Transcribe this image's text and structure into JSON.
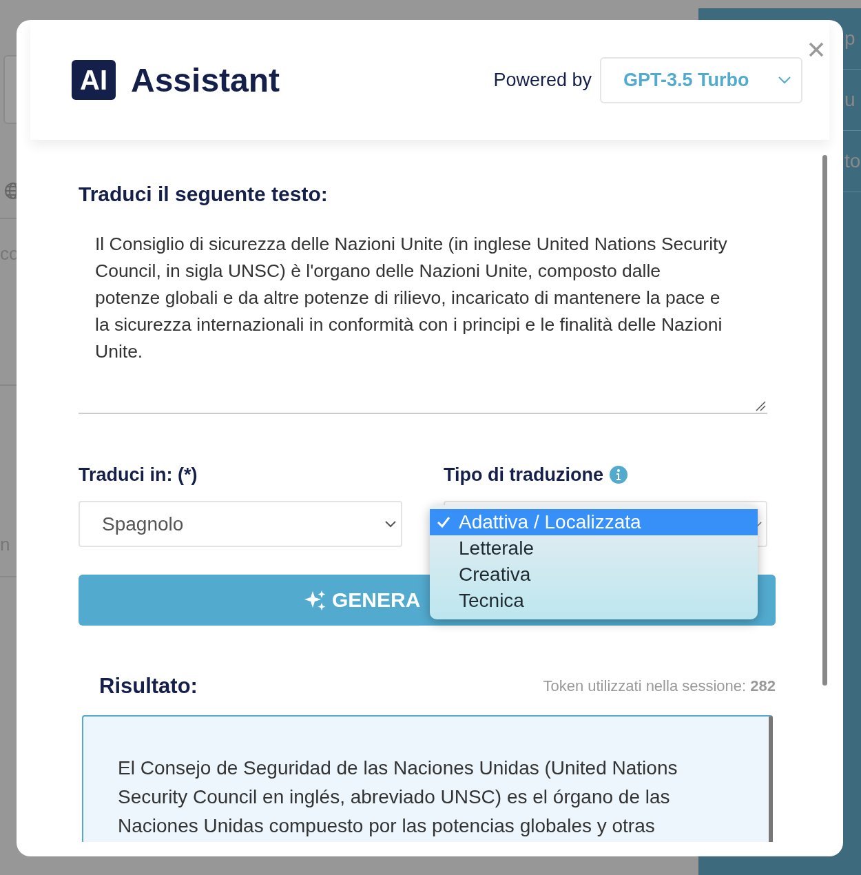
{
  "background": {
    "left_texts": [
      "co",
      "n"
    ],
    "right_texts": [
      "p",
      "u",
      "to"
    ]
  },
  "header": {
    "logo": "AI",
    "title": "Assistant",
    "powered_by": "Powered by",
    "model": "GPT-3.5 Turbo"
  },
  "source": {
    "label": "Traduci il seguente testo:",
    "value": "Il Consiglio di sicurezza delle Nazioni Unite (in inglese United Nations Security Council, in sigla UNSC) è l'organo delle Nazioni Unite, composto dalle potenze globali e da altre potenze di rilievo, incaricato di mantenere la pace e la sicurezza internazionali in conformità con i principi e le finalità delle Nazioni Unite."
  },
  "target_language": {
    "label": "Traduci in: (*)",
    "value": "Spagnolo"
  },
  "translation_type": {
    "label": "Tipo di traduzione",
    "open": true,
    "options": [
      {
        "label": "Adattiva / Localizzata",
        "selected": true
      },
      {
        "label": "Letterale",
        "selected": false
      },
      {
        "label": "Creativa",
        "selected": false
      },
      {
        "label": "Tecnica",
        "selected": false
      }
    ]
  },
  "generate_button": {
    "label": "GENERA"
  },
  "result": {
    "label": "Risultato:",
    "tokens": "Token utilizzati nella sessione: **282**",
    "lines": [
      "El Consejo de Seguridad de las Naciones Unidas (United Nations",
      "Security Council en inglés, abreviado UNSC) es el órgano de las",
      "Naciones Unidas compuesto por las potencias globales y otras"
    ]
  }
}
